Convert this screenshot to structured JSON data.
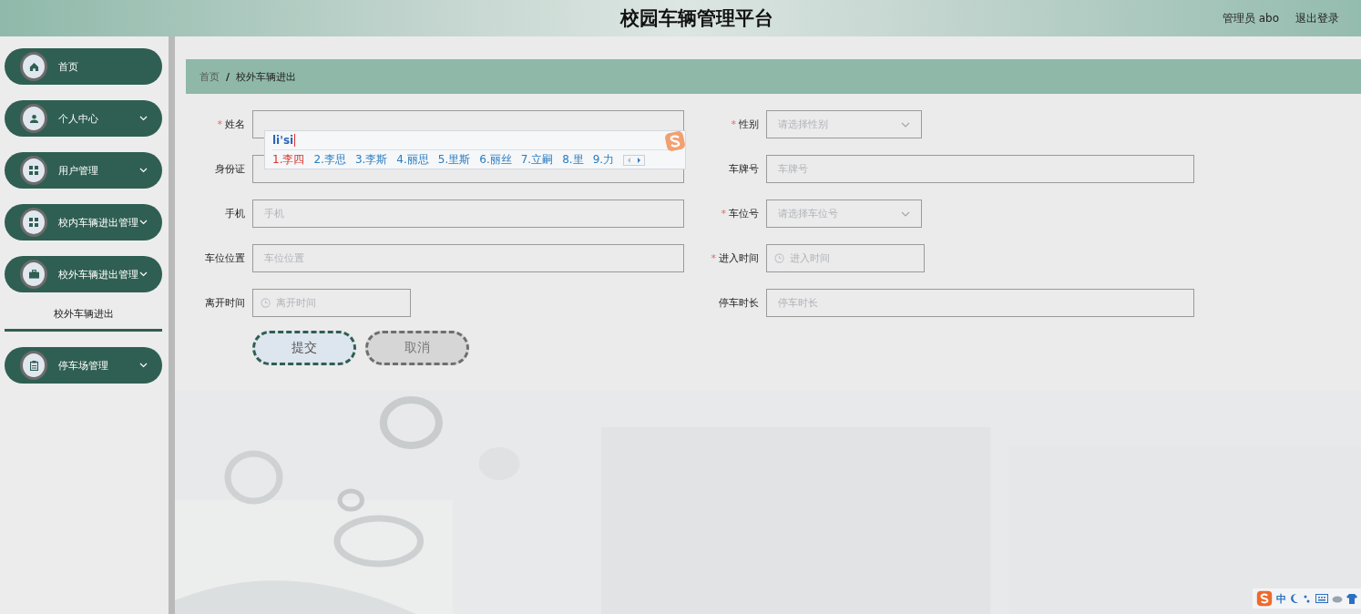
{
  "header": {
    "title": "校园车辆管理平台",
    "user": "管理员 abo",
    "logout": "退出登录"
  },
  "sidebar": {
    "items": [
      {
        "label": "首页",
        "kind": "link"
      },
      {
        "label": "个人中心",
        "kind": "submenu"
      },
      {
        "label": "用户管理",
        "kind": "submenu"
      },
      {
        "label": "校内车辆进出管理",
        "kind": "submenu"
      },
      {
        "label": "校外车辆进出管理",
        "kind": "submenu",
        "children": [
          {
            "label": "校外车辆进出",
            "selected": true
          }
        ]
      },
      {
        "label": "停车场管理",
        "kind": "submenu"
      }
    ]
  },
  "breadcrumb": [
    "首页",
    "/",
    "校外车辆进出"
  ],
  "form": {
    "required_mark": "*",
    "fields": [
      {
        "label": "姓名",
        "required": true,
        "kind": "text"
      },
      {
        "label": "性别",
        "required": true,
        "kind": "select",
        "placeholder": "请选择性别"
      },
      {
        "label": "身份证",
        "required": false,
        "kind": "text"
      },
      {
        "label": "车牌号",
        "required": false,
        "kind": "text",
        "placeholder": "车牌号"
      },
      {
        "label": "手机",
        "required": false,
        "kind": "text",
        "placeholder": "手机"
      },
      {
        "label": "车位号",
        "required": true,
        "kind": "select",
        "placeholder": "请选择车位号"
      },
      {
        "label": "车位位置",
        "required": false,
        "kind": "text",
        "placeholder": "车位位置"
      },
      {
        "label": "进入时间",
        "required": true,
        "kind": "date",
        "placeholder": "进入时间"
      },
      {
        "label": "离开时间",
        "required": false,
        "kind": "date",
        "placeholder": "离开时间"
      },
      {
        "label": "停车时长",
        "required": false,
        "kind": "text",
        "placeholder": "停车时长"
      }
    ],
    "buttons": [
      {
        "label": "提交",
        "kind": "primary"
      },
      {
        "label": "取消",
        "kind": "secondary"
      }
    ]
  },
  "ime": {
    "composition": "li'si",
    "candidates": [
      {
        "text": "1.李四",
        "selected": true
      },
      {
        "text": "2.李思",
        "selected": false
      },
      {
        "text": "3.李斯",
        "selected": false
      },
      {
        "text": "4.丽思",
        "selected": false
      },
      {
        "text": "5.里斯",
        "selected": false
      },
      {
        "text": "6.丽丝",
        "selected": false
      },
      {
        "text": "7.立嗣",
        "selected": false
      },
      {
        "text": "8.里",
        "selected": false
      },
      {
        "text": "9.力",
        "selected": false
      }
    ],
    "toolbar_mode": "中"
  }
}
